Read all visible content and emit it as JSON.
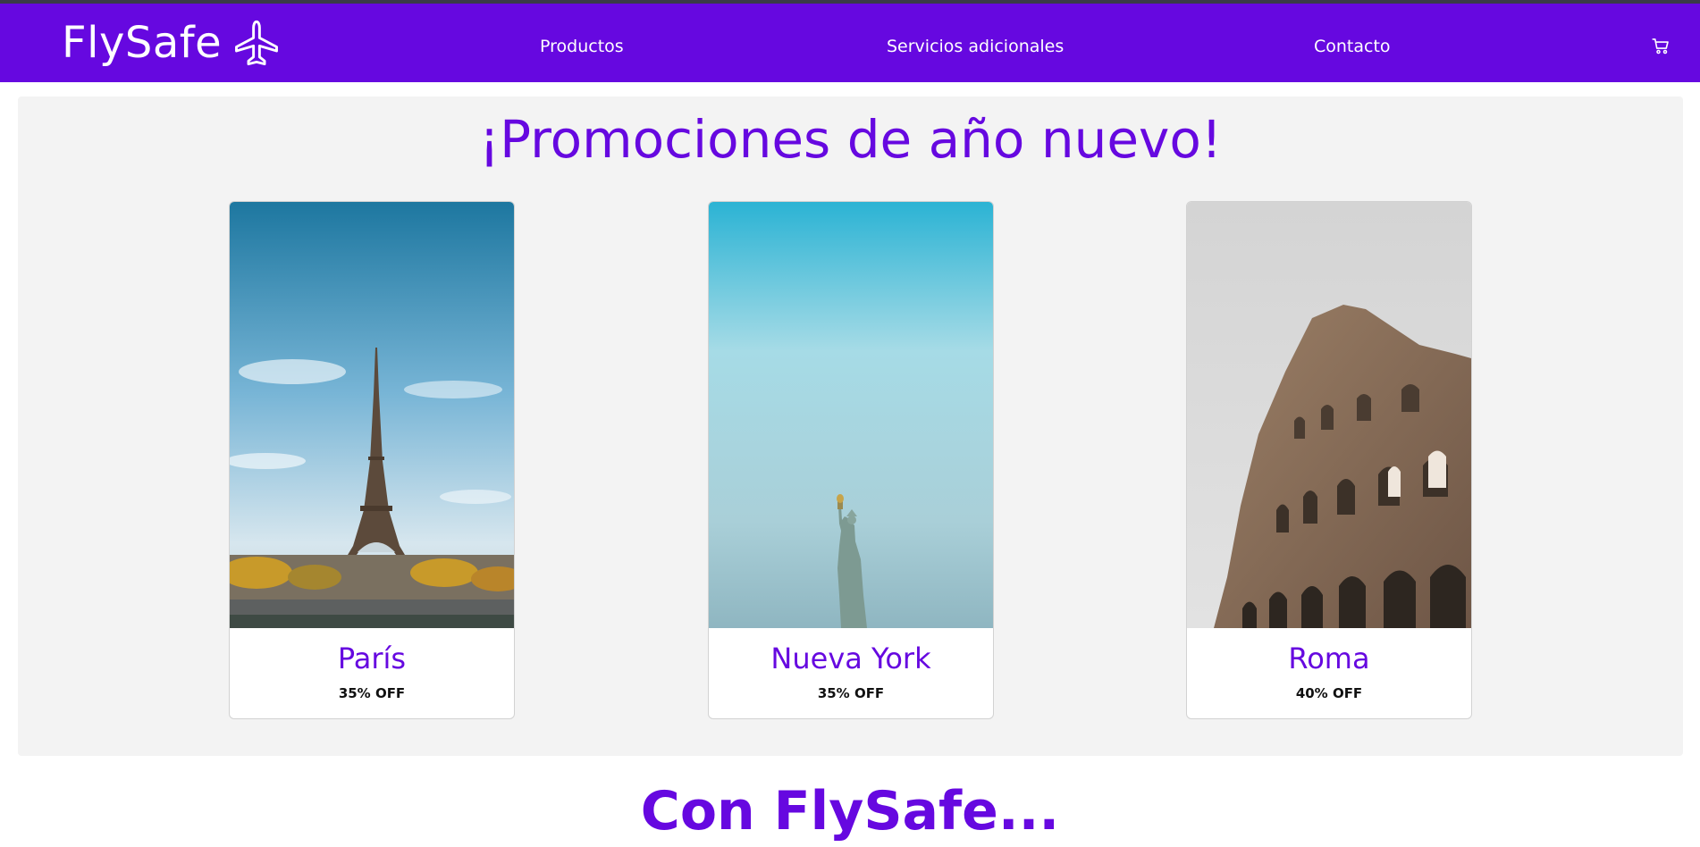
{
  "header": {
    "brand": "FlySafe",
    "nav": [
      "Productos",
      "Servicios adicionales",
      "Contacto"
    ],
    "cart_icon": "cart-icon",
    "plane_icon": "airplane-icon",
    "color": "#6608e0"
  },
  "promo": {
    "title": "¡Promociones de año nuevo!",
    "cards": [
      {
        "city": "París",
        "discount": "35% OFF",
        "image": "eiffel-tower-photo"
      },
      {
        "city": "Nueva York",
        "discount": "35% OFF",
        "image": "statue-of-liberty-photo"
      },
      {
        "city": "Roma",
        "discount": "40% OFF",
        "image": "colosseum-photo"
      }
    ]
  },
  "section2": {
    "title": "Con FlySafe..."
  }
}
